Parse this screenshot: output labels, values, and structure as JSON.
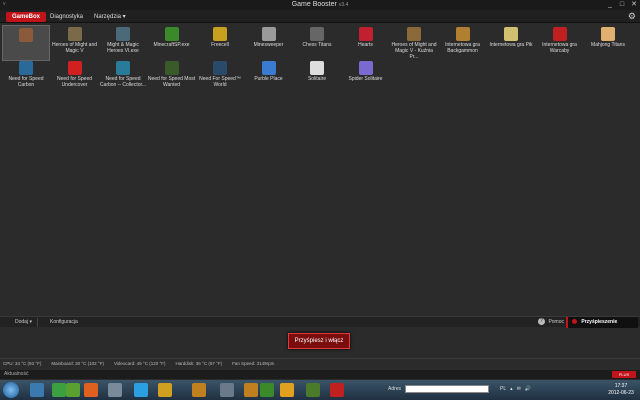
{
  "window": {
    "version_small": "v",
    "title": "Game Booster",
    "title_ver": "v3.4",
    "controls": [
      "_",
      "□",
      "✕"
    ]
  },
  "nav": {
    "tabs": [
      "GameBox",
      "Diagnostyka",
      "Narzędzia ▾"
    ]
  },
  "tiles": [
    {
      "label": "",
      "color": "#8a5a3a"
    },
    {
      "label": "Heroes of Might and Magic V",
      "color": "#7a6a4a"
    },
    {
      "label": "Might & Magic Heroes VI.exe",
      "color": "#4a6a7a"
    },
    {
      "label": "MinecraftSP.exe",
      "color": "#3a8a2a"
    },
    {
      "label": "Freecell",
      "color": "#c8a020"
    },
    {
      "label": "Minesweeper",
      "color": "#9a9a9a"
    },
    {
      "label": "Chess Titans",
      "color": "#666"
    },
    {
      "label": "Hearts",
      "color": "#c02030"
    },
    {
      "label": "Heroes of Might and Magic V - Kuźnia Pr...",
      "color": "#8a6a3a"
    },
    {
      "label": "Internetowa gra Backgammon",
      "color": "#b08030"
    },
    {
      "label": "Internetowa gra Pik",
      "color": "#d0c070"
    },
    {
      "label": "Internetowa gra Warcaby",
      "color": "#c02020"
    },
    {
      "label": "Mahjong Titans",
      "color": "#e0b070"
    },
    {
      "label": "Need for Speed Carbon",
      "color": "#2a6a9a"
    },
    {
      "label": "Need for Speed Undercover",
      "color": "#d02020"
    },
    {
      "label": "Need for Speed Carbon -- Collector...",
      "color": "#2a7a9a"
    },
    {
      "label": "Need for Speed Most Wanted",
      "color": "#3a5a2a"
    },
    {
      "label": "Need For Speed™ World",
      "color": "#2a4a6a"
    },
    {
      "label": "Purble Place",
      "color": "#3a7ad0"
    },
    {
      "label": "Solitaire",
      "color": "#dddddd"
    },
    {
      "label": "Spider Solitaire",
      "color": "#7a6ad0"
    }
  ],
  "bottom": {
    "add": "Dodaj ▾",
    "config": "Konfiguracja",
    "help": "Pomoc",
    "accelerate": "Przyśpieszenie"
  },
  "boost_button": "Przyśpiesz i włącz",
  "status": [
    "CPU: 34 °C (93 °F)",
    "Mainboard: 30 °C (102 °F)",
    "Videocard: 49 °C (120 °F)",
    "Harddisk: 36 °C (97 °F)",
    "Fan Speed: 3149rpm"
  ],
  "update": {
    "text": "Aktualność",
    "badge": "PLUS"
  },
  "taskbar": {
    "icons": [
      {
        "name": "folder-icon",
        "color": "#3a7ab0"
      },
      {
        "name": "media-player-icon",
        "color": "#3aa040"
      },
      {
        "name": "utorrent-icon",
        "color": "#5aa030"
      },
      {
        "name": "firefox-icon",
        "color": "#e06020"
      },
      {
        "name": "settings-icon",
        "color": "#7a8a9a"
      },
      {
        "name": "skype-icon",
        "color": "#2aa0e0"
      },
      {
        "name": "chrome-icon",
        "color": "#d0a020"
      },
      {
        "name": "winamp-icon",
        "color": "#c08020"
      },
      {
        "name": "network-icon",
        "color": "#6a7a8a"
      },
      {
        "name": "game-icon",
        "color": "#c08020"
      },
      {
        "name": "minecraft-icon",
        "color": "#3a8a2a"
      },
      {
        "name": "sun-icon",
        "color": "#e0a020"
      },
      {
        "name": "minecraft2-icon",
        "color": "#4a7a2a"
      },
      {
        "name": "game-booster-icon",
        "color": "#c02020"
      }
    ],
    "address_label": "Adres",
    "tray": [
      "PL",
      "▴",
      "✉",
      "🔊"
    ],
    "time": "17:37",
    "date": "2012-06-23"
  }
}
